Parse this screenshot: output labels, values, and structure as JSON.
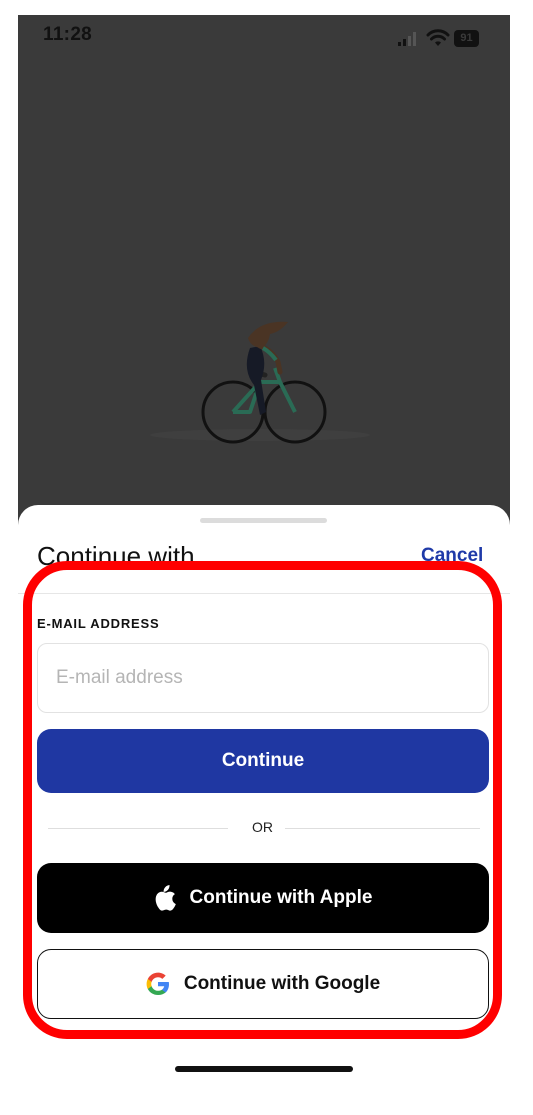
{
  "status_bar": {
    "time": "11:28",
    "battery": "91"
  },
  "sheet": {
    "title": "Continue with",
    "cancel_label": "Cancel",
    "email": {
      "label": "E-MAIL ADDRESS",
      "placeholder": "E-mail address",
      "value": ""
    },
    "continue_label": "Continue",
    "divider_text": "OR",
    "apple_label": "Continue with Apple",
    "google_label": "Continue with Google"
  },
  "colors": {
    "accent": "#1f37a2",
    "link": "#1f3aa8",
    "apple_button": "#000000",
    "highlight": "#ff0000",
    "backdrop": "#3a3a3a"
  },
  "icons": {
    "signal": "signal-icon",
    "wifi": "wifi-icon",
    "apple": "apple-icon",
    "google": "google-icon"
  }
}
